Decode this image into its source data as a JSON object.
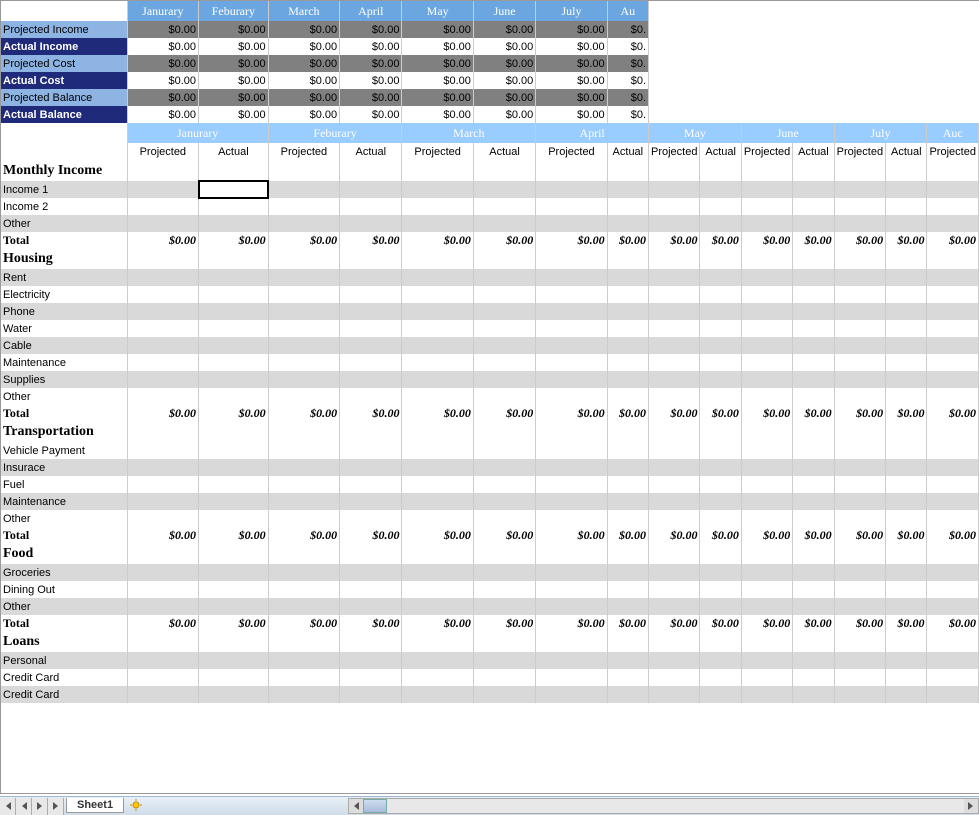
{
  "months": [
    "Janurary",
    "Feburary",
    "March",
    "April",
    "May",
    "June",
    "July",
    "Au"
  ],
  "months_partial_last": "Auc",
  "summary_rows": [
    {
      "label": "Projected Income",
      "style": "row-proj-income",
      "data_bg": "summary-data"
    },
    {
      "label": "Actual Income",
      "style": "row-actual-income",
      "data_bg": "summary-white"
    },
    {
      "label": "Projected Cost",
      "style": "row-proj-cost",
      "data_bg": "summary-data"
    },
    {
      "label": "Actual Cost",
      "style": "row-actual-cost",
      "data_bg": "summary-white"
    },
    {
      "label": "Projected Balance",
      "style": "row-proj-balance",
      "data_bg": "summary-data"
    },
    {
      "label": "Actual Balance",
      "style": "row-actual-balance",
      "data_bg": "summary-white"
    }
  ],
  "summary_value": "$0.00",
  "summary_value_last": "$0.",
  "sub_headers": [
    "Projected",
    "Actual"
  ],
  "sections": [
    {
      "title": "Monthly Income",
      "items": [
        "Income 1",
        "Income 2",
        "Other"
      ],
      "total": true,
      "start_odd": true
    },
    {
      "title": "Housing",
      "items": [
        "Rent",
        "Electricity",
        "Phone",
        "Water",
        "Cable",
        "Maintenance",
        "Supplies",
        "Other"
      ],
      "total": true,
      "start_odd": true
    },
    {
      "title": "Transportation",
      "items": [
        "Vehicle Payment",
        "Insurace",
        "Fuel",
        "Maintenance",
        "Other"
      ],
      "total": true,
      "start_odd": false
    },
    {
      "title": "Food",
      "items": [
        "Groceries",
        "Dining Out",
        "Other"
      ],
      "total": true,
      "start_odd": true
    },
    {
      "title": "Loans",
      "items": [
        "Personal",
        "Credit Card",
        "Credit Card"
      ],
      "total": false,
      "start_odd": true
    }
  ],
  "total_label": "Total",
  "total_value": "$0.00",
  "tab": {
    "name": "Sheet1"
  }
}
